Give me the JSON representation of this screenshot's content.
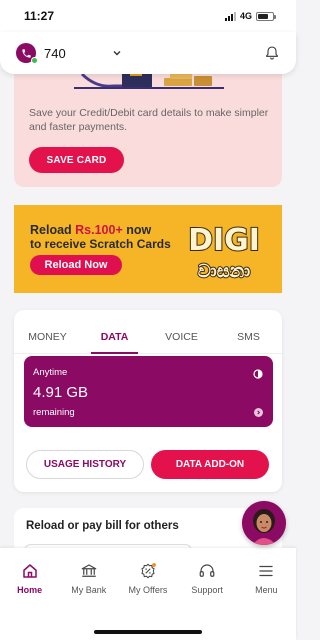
{
  "status_bar": {
    "time": "11:27",
    "network": "4G"
  },
  "header": {
    "number": "740",
    "icons": [
      "phone-icon",
      "chevron-down-icon",
      "bell-icon"
    ]
  },
  "save_card": {
    "description": "Save your Credit/Debit card details to make simpler and faster payments.",
    "button_label": "SAVE CARD"
  },
  "promo": {
    "line1_prefix": "Reload ",
    "line1_amount": "Rs.100+",
    "line1_suffix": " now",
    "line2": "to receive Scratch Cards",
    "button_label": "Reload Now",
    "logo_text_1": "DIGI",
    "logo_text_2": "වාසනා"
  },
  "balance": {
    "tabs": [
      {
        "label": "MONEY"
      },
      {
        "label": "DATA"
      },
      {
        "label": "VOICE"
      },
      {
        "label": "SMS"
      }
    ],
    "active_tab": "DATA",
    "data_box": {
      "title": "Anytime",
      "value": "4.91 GB",
      "caption": "remaining"
    },
    "usage_button": "USAGE HISTORY",
    "addon_button": "DATA ADD-ON"
  },
  "reload_section": {
    "title": "Reload or pay bill for others"
  },
  "bottom_nav": {
    "items": [
      {
        "label": "Home",
        "icon": "home-icon"
      },
      {
        "label": "My Bank",
        "icon": "bank-icon"
      },
      {
        "label": "My Offers",
        "icon": "offers-icon"
      },
      {
        "label": "Support",
        "icon": "headset-icon"
      },
      {
        "label": "Menu",
        "icon": "menu-icon"
      }
    ]
  },
  "colors": {
    "brand": "#8b0a63",
    "accent": "#e3124d",
    "banner": "#f5b526",
    "save_card_bg": "#f9dcdb"
  }
}
